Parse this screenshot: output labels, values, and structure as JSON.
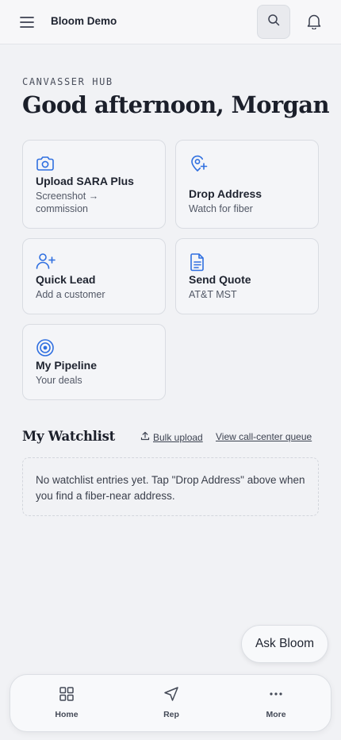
{
  "header": {
    "title": "Bloom Demo",
    "icons": {
      "menu": "hamburger-icon",
      "search": "search-icon",
      "notifications": "bell-icon"
    }
  },
  "hero": {
    "eyebrow": "CANVASSER HUB",
    "greeting": "Good afternoon, Morgan"
  },
  "actions": [
    {
      "title": "Upload SARA Plus",
      "subtitle_line1": "Screenshot →",
      "subtitle_line2": "commission",
      "icon": "camera-icon"
    },
    {
      "title": "Drop Address",
      "subtitle": "Watch for fiber",
      "icon": "map-pin-plus-icon"
    },
    {
      "title": "Quick Lead",
      "subtitle": "Add a customer",
      "icon": "user-plus-icon"
    },
    {
      "title": "Send Quote",
      "subtitle": "AT&T MST",
      "icon": "document-icon"
    },
    {
      "title": "My Pipeline",
      "subtitle": "Your deals",
      "icon": "target-icon"
    }
  ],
  "watchlist": {
    "title": "My Watchlist",
    "bulk_upload": "Bulk upload",
    "queue_link": "View call-center queue",
    "empty_text": "No watchlist entries yet. Tap \"Drop Address\" above when you find a fiber-near address."
  },
  "assistant": {
    "label": "Ask Bloom"
  },
  "nav": [
    {
      "label": "Home",
      "icon": "grid-icon"
    },
    {
      "label": "Rep",
      "icon": "navigation-icon"
    },
    {
      "label": "More",
      "icon": "more-dots-icon"
    }
  ],
  "colors": {
    "accent": "#2f6fe0",
    "background": "#f1f2f5",
    "text": "#1f2430"
  }
}
